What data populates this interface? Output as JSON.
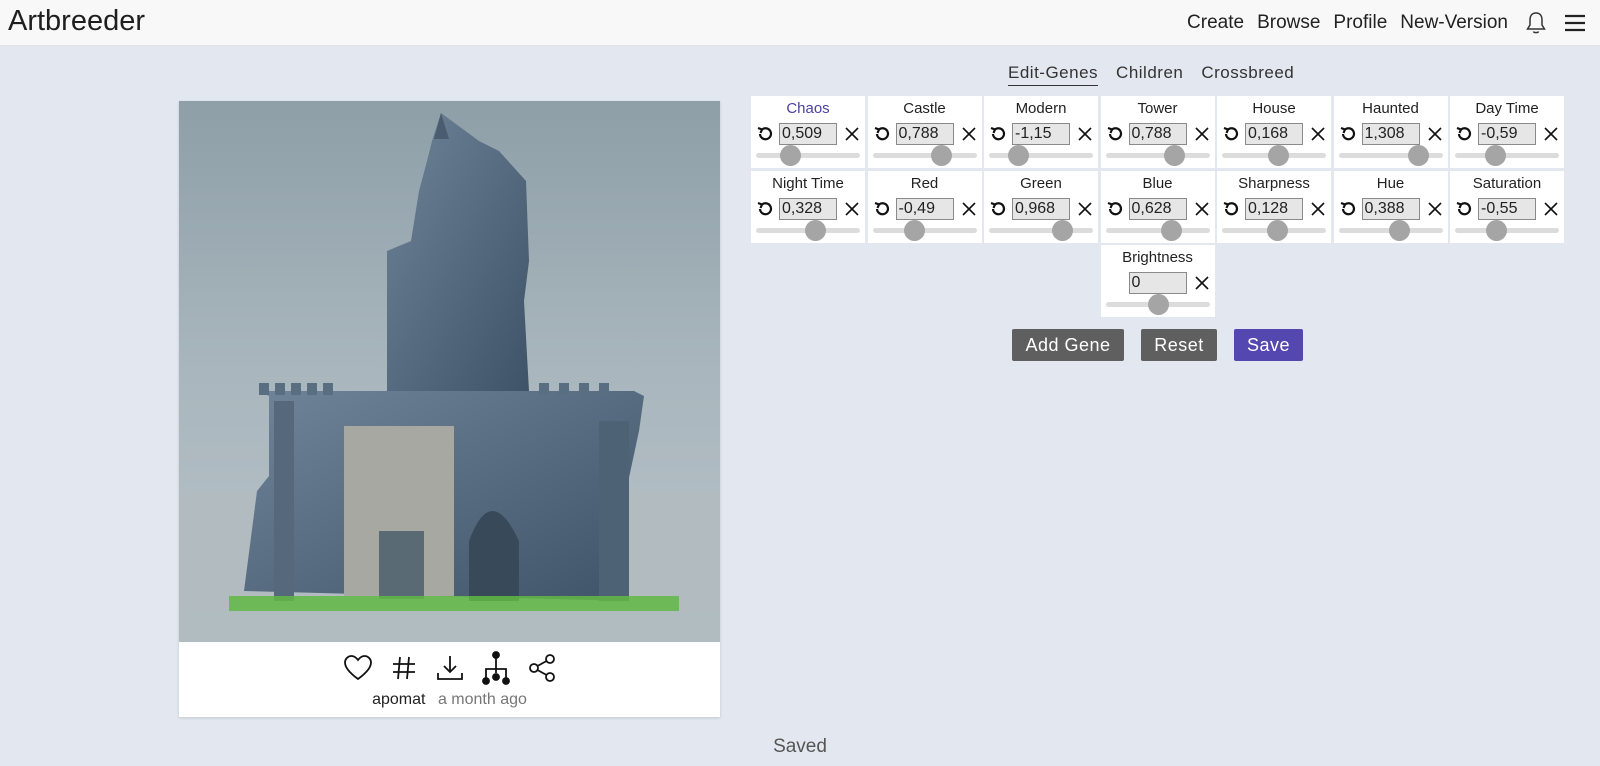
{
  "app": {
    "title": "Artbreeder"
  },
  "nav": {
    "create": "Create",
    "browse": "Browse",
    "profile": "Profile",
    "new_version": "New-Version"
  },
  "card": {
    "user": "apomat",
    "time": "a month ago"
  },
  "tabs": [
    "Edit-Genes",
    "Children",
    "Crossbreed"
  ],
  "genes": [
    {
      "name": "Chaos",
      "value": "0,509",
      "level": 0.33
    },
    {
      "name": "Castle",
      "value": "0,788",
      "level": 0.66
    },
    {
      "name": "Modern",
      "value": "-1,15",
      "level": 0.28
    },
    {
      "name": "Tower",
      "value": "0,788",
      "level": 0.66
    },
    {
      "name": "House",
      "value": "0,168",
      "level": 0.54
    },
    {
      "name": "Haunted",
      "value": "1,308",
      "level": 0.76
    },
    {
      "name": "Day Time",
      "value": "-0,59",
      "level": 0.38
    },
    {
      "name": "Night Time",
      "value": "0,328",
      "level": 0.57
    },
    {
      "name": "Red",
      "value": "-0,49",
      "level": 0.4
    },
    {
      "name": "Green",
      "value": "0,968",
      "level": 0.7
    },
    {
      "name": "Blue",
      "value": "0,628",
      "level": 0.63
    },
    {
      "name": "Sharpness",
      "value": "0,128",
      "level": 0.53
    },
    {
      "name": "Hue",
      "value": "0,388",
      "level": 0.58
    },
    {
      "name": "Saturation",
      "value": "-0,55",
      "level": 0.39
    },
    {
      "name": "Brightness",
      "value": "0",
      "level": 0.5
    }
  ],
  "buttons": {
    "add_gene": "Add Gene",
    "reset": "Reset",
    "save": "Save"
  },
  "status": "Saved",
  "colors": {
    "accent": "#5547b0",
    "background": "#e3e8f0",
    "button_gray": "#5f5f5f"
  }
}
